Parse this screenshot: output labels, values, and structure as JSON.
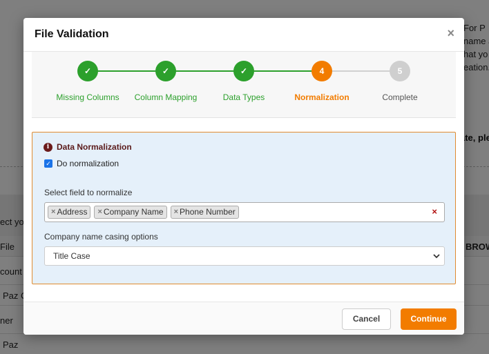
{
  "background": {
    "right_lines": [
      "For P",
      "name a",
      "hat yo",
      "eation."
    ],
    "right_bold": "ate, ple",
    "left_lines": [
      "ect yo",
      "File",
      "count",
      "Paz C",
      "ner",
      "Paz"
    ],
    "col_header": "BROW"
  },
  "modal": {
    "title": "File Validation",
    "close_glyph": "×"
  },
  "stepper": {
    "steps": [
      {
        "label": "Missing Columns",
        "status": "done",
        "glyph": "✓"
      },
      {
        "label": "Column Mapping",
        "status": "done",
        "glyph": "✓"
      },
      {
        "label": "Data Types",
        "status": "done",
        "glyph": "✓"
      },
      {
        "label": "Normalization",
        "status": "active",
        "glyph": "4"
      },
      {
        "label": "Complete",
        "status": "todo",
        "glyph": "5"
      }
    ],
    "colors": {
      "done": "#2ca02c",
      "active": "#f27c00",
      "todo": "#cfcfcf"
    }
  },
  "normalization": {
    "title": "Data Normalization",
    "info_icon": "info-circle-icon",
    "checkbox_label": "Do normalization",
    "checkbox_checked": true,
    "field_label": "Select field to normalize",
    "selected_fields": [
      "Address",
      "Company Name",
      "Phone Number"
    ],
    "tag_remove_glyph": "×",
    "clear_glyph": "×",
    "casing_label": "Company name casing options",
    "casing_value": "Title Case"
  },
  "footer": {
    "cancel_label": "Cancel",
    "continue_label": "Continue"
  }
}
